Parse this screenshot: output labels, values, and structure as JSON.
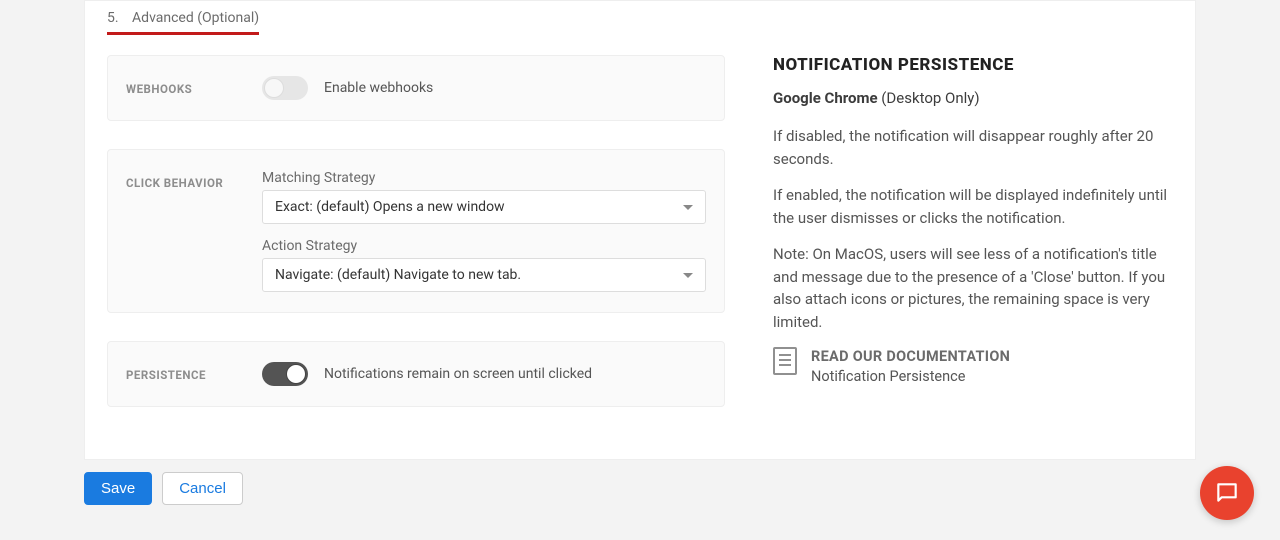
{
  "tab": {
    "num": "5.",
    "label": "Advanced (Optional)"
  },
  "webhooks": {
    "label": "WEBHOOKS",
    "toggle_label": "Enable webhooks"
  },
  "click_behavior": {
    "label": "CLICK BEHAVIOR",
    "matching_label": "Matching Strategy",
    "matching_value": "Exact: (default) Opens a new window",
    "action_label": "Action Strategy",
    "action_value": "Navigate: (default) Navigate to new tab."
  },
  "persistence": {
    "label": "PERSISTENCE",
    "toggle_label": "Notifications remain on screen until clicked"
  },
  "panel": {
    "title": "NOTIFICATION PERSISTENCE",
    "sub_strong": "Google Chrome",
    "sub_rest": " (Desktop Only)",
    "p1": "If disabled, the notification will disappear roughly after 20 seconds.",
    "p2": "If enabled, the notification will be displayed indefinitely until the user dismisses or clicks the notification.",
    "p3": "Note: On MacOS, users will see less of a notification's title and message due to the presence of a 'Close' button. If you also attach icons or pictures, the remaining space is very limited.",
    "doc_title": "READ OUR DOCUMENTATION",
    "doc_link": "Notification Persistence"
  },
  "buttons": {
    "save": "Save",
    "cancel": "Cancel"
  }
}
